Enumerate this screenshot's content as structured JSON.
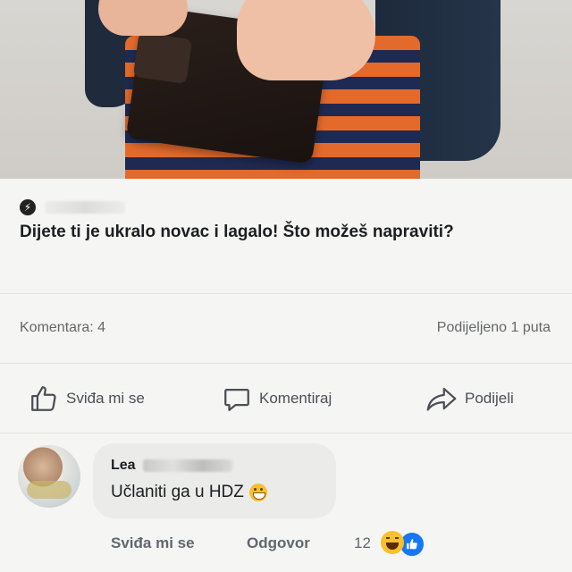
{
  "post": {
    "headline": "Dijete ti je ukralo novac i lagalo! Što možeš napraviti?",
    "stats": {
      "comments": "Komentara: 4",
      "shares": "Podijeljeno 1 puta"
    },
    "actions": {
      "like": "Sviđa mi se",
      "comment": "Komentiraj",
      "share": "Podijeli"
    }
  },
  "comment": {
    "author": "Lea",
    "text": "Učlaniti ga u HDZ",
    "actions": {
      "like": "Sviđa mi se",
      "reply": "Odgovor"
    },
    "reaction_count": "12",
    "reactions": [
      "haha",
      "like"
    ]
  },
  "colors": {
    "background": "#f5f5f3",
    "bubble": "#ebebea",
    "secondary_text": "#65676b",
    "like_blue": "#1877f2"
  }
}
